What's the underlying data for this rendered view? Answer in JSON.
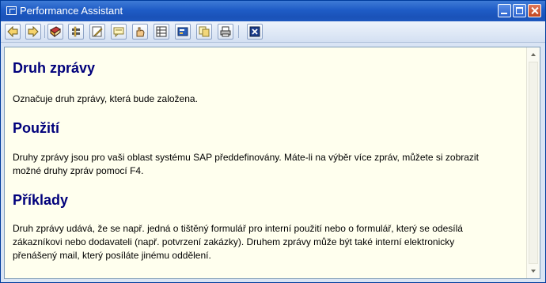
{
  "window": {
    "title": "Performance Assistant",
    "title_color": "#ffffff",
    "titlebar_color": "#1f5cc6"
  },
  "toolbar": {
    "buttons": [
      {
        "name": "back",
        "icon": "arrow-left-icon"
      },
      {
        "name": "forward",
        "icon": "arrow-right-icon"
      },
      {
        "name": "help",
        "icon": "book-icon"
      },
      {
        "name": "technical-info",
        "icon": "tools-icon"
      },
      {
        "name": "edit",
        "icon": "pencil-icon"
      },
      {
        "name": "annotate",
        "icon": "note-icon"
      },
      {
        "name": "glossary",
        "icon": "hand-icon"
      },
      {
        "name": "table-of-contents",
        "icon": "table-icon"
      },
      {
        "name": "settings",
        "icon": "card-icon"
      },
      {
        "name": "copy",
        "icon": "copy-icon"
      },
      {
        "name": "print",
        "icon": "printer-icon"
      },
      {
        "name": "close",
        "icon": "close-x-icon"
      }
    ]
  },
  "content": {
    "heading_color": "#00007b",
    "background": "#ffffee",
    "sections": [
      {
        "heading": "Druh zprávy",
        "lines": [
          "Označuje druh zprávy, která bude založena."
        ]
      },
      {
        "heading": "Použití",
        "lines": [
          "Druhy zprávy jsou pro vaši oblast systému SAP předdefinovány. Máte-li na výběr více zpráv, můžete si zobrazit",
          "možné druhy zpráv pomocí F4."
        ]
      },
      {
        "heading": "Příklady",
        "lines": [
          "Druh zprávy udává, že se např. jedná o tištěný formulář pro interní použití nebo o formulář, který se odesílá",
          "zákazníkovi nebo dodavateli (např. potvrzení zakázky). Druhem zprávy může být také interní elektronicky",
          "přenášený mail, který posíláte jinému oddělení."
        ]
      }
    ]
  }
}
